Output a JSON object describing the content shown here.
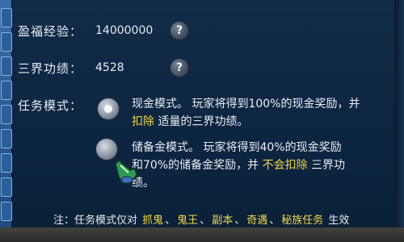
{
  "experience": {
    "label": "盈福经验：",
    "value": "14000000"
  },
  "merit": {
    "label": "三界功绩：",
    "value": "4528"
  },
  "task_mode": {
    "label": "任务模式：",
    "options": [
      {
        "line1": "现金模式。 玩家将得到100%的现金奖励，并",
        "line2_highlight": "扣除",
        "line2_rest": " 适量的三界功绩。",
        "selected": true
      },
      {
        "line1": "储备金模式。 玩家将得到40%的现金奖励",
        "line2_prefix": "和70%的储备金奖励，并 ",
        "line2_highlight": "不会扣除",
        "line2_rest": " 三界功",
        "line3": "绩。",
        "selected": false
      }
    ]
  },
  "note": {
    "prefix": "注：任务模式仅对 ",
    "items": [
      "抓鬼",
      "鬼王",
      "副本",
      "奇遇",
      "秘族任务"
    ],
    "suffix": "生效"
  },
  "icons": {
    "help": "?",
    "help_icon": "question-mark-circle-icon",
    "cursor": "hand-pointer-icon"
  },
  "colors": {
    "highlight": "#f2d64a",
    "background": "#0c2540"
  }
}
